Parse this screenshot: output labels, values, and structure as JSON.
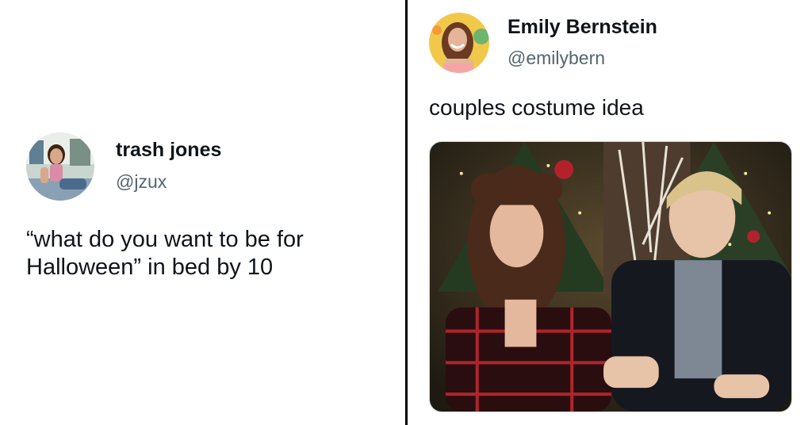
{
  "left_tweet": {
    "display_name": "trash jones",
    "handle": "@jzux",
    "text": "“what do you want to be for Halloween” in bed by 10",
    "avatar_icon": "profile-photo-icon"
  },
  "right_tweet": {
    "display_name": "Emily Bernstein",
    "handle": "@emilybern",
    "text": "couples costume idea",
    "avatar_icon": "profile-photo-icon",
    "media_icon": "video-still-image"
  },
  "colors": {
    "text_primary": "#0f1419",
    "text_secondary": "#536471",
    "divider": "#000000",
    "background": "#ffffff"
  }
}
